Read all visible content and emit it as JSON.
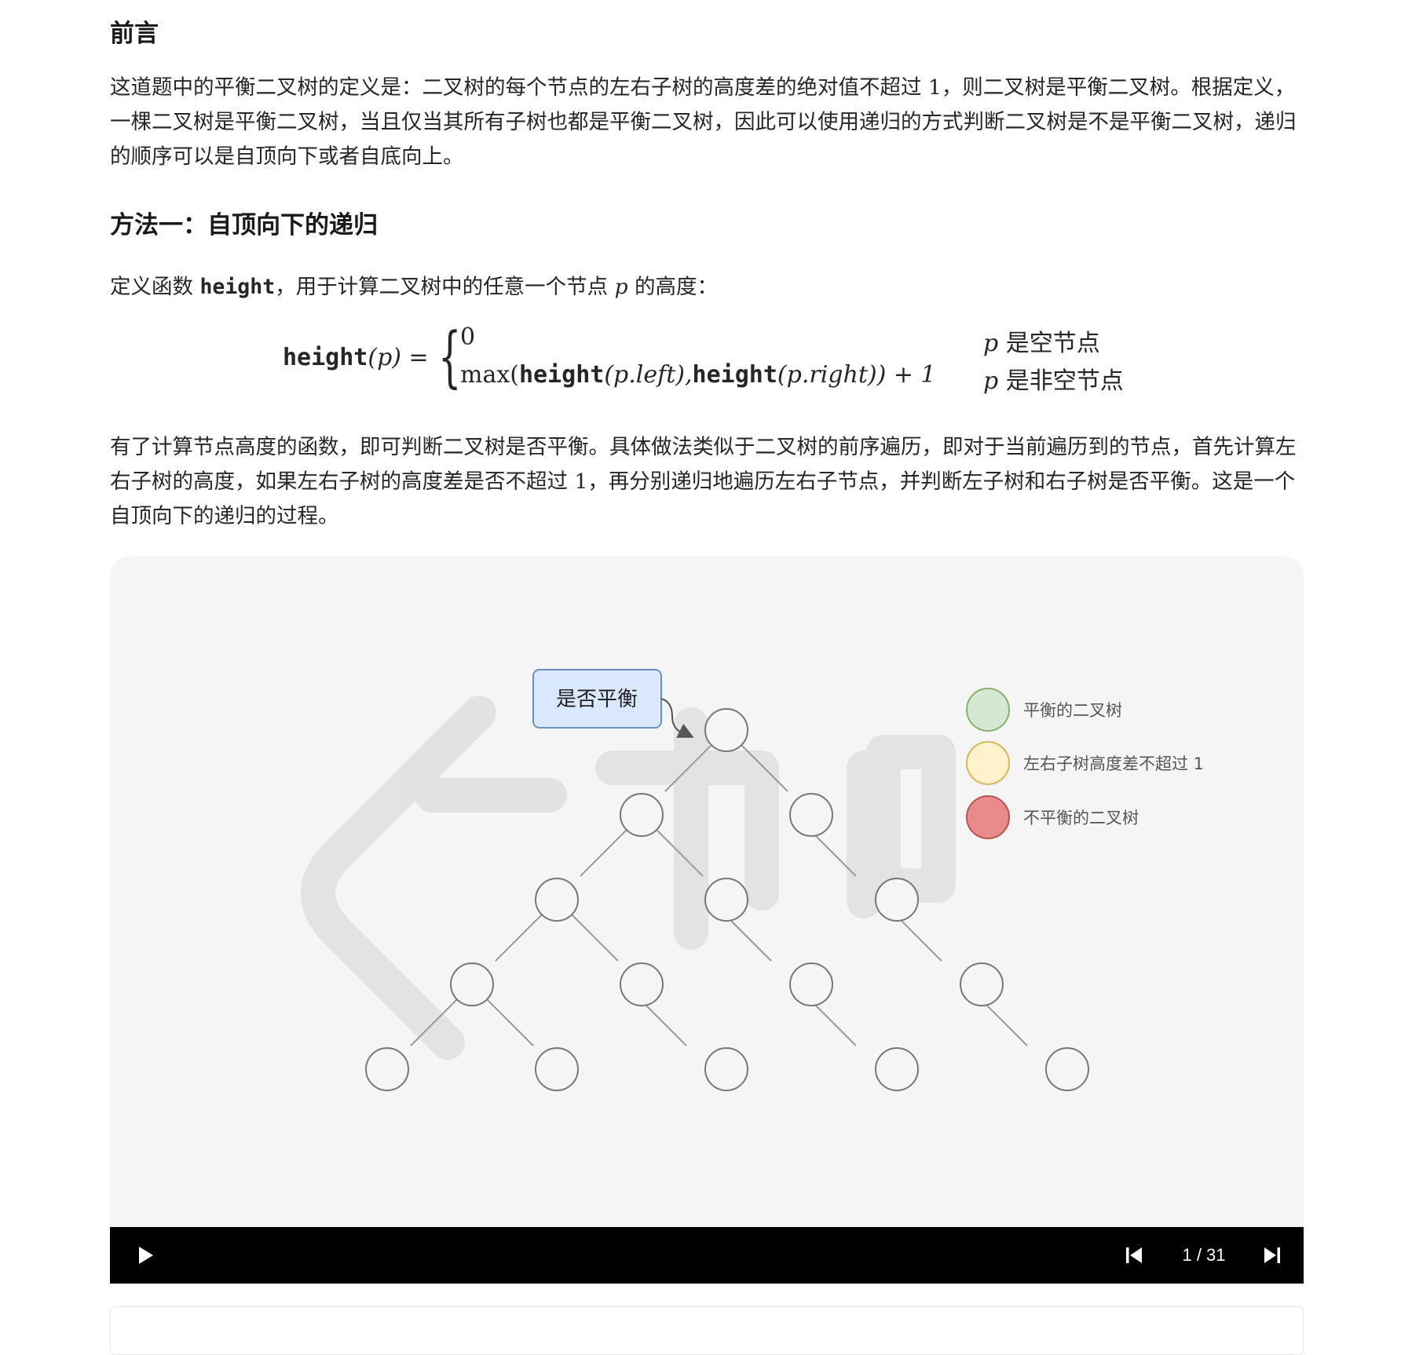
{
  "intro": {
    "heading": "前言",
    "paragraph_pre": "这道题中的平衡二叉树的定义是：二叉树的每个节点的左右子树的高度差的绝对值不超过 ",
    "paragraph_num": "1",
    "paragraph_post": "，则二叉树是平衡二叉树。根据定义，一棵二叉树是平衡二叉树，当且仅当其所有子树也都是平衡二叉树，因此可以使用递归的方式判断二叉树是不是平衡二叉树，递归的顺序可以是自顶向下或者自底向上。"
  },
  "method1": {
    "heading": "方法一：自顶向下的递归",
    "def_pre": "定义函数 ",
    "def_code": "height",
    "def_mid": "，用于计算二叉树中的任意一个节点 ",
    "def_var": "p",
    "def_post": " 的高度：",
    "formula": {
      "lhs_func": "height",
      "lhs_arg": "(p) =",
      "case1_value": "0",
      "case1_cond_var": "p",
      "case1_cond": "是空节点",
      "case2_max": "max(",
      "case2_h1": "height",
      "case2_a1": "(p.left),",
      "case2_h2": "height",
      "case2_a2": "(p.right)) + 1",
      "case2_cond_var": "p",
      "case2_cond": "是非空节点"
    },
    "para2_pre": "有了计算节点高度的函数，即可判断二叉树是否平衡。具体做法类似于二叉树的前序遍历，即对于当前遍历到的节点，首先计算左右子树的高度，如果左右子树的高度差是否不超过 ",
    "para2_num": "1",
    "para2_post": "，再分别递归地遍历左右子节点，并判断左子树和右子树是否平衡。这是一个自顶向下的递归的过程。"
  },
  "animation": {
    "callout_label": "是否平衡",
    "legend": [
      {
        "label": "平衡的二叉树",
        "color": "#d5e8d4"
      },
      {
        "label": "左右子树高度差不超过 1",
        "color": "#fff2cc"
      },
      {
        "label": "不平衡的二叉树",
        "color": "#ea8b8b"
      }
    ],
    "player": {
      "counter": "1 / 31"
    }
  },
  "colors": {
    "callout_fill": "#dae8fc",
    "callout_stroke": "#6c8ebf",
    "node_stroke": "#666666",
    "player_bg": "#000000"
  }
}
